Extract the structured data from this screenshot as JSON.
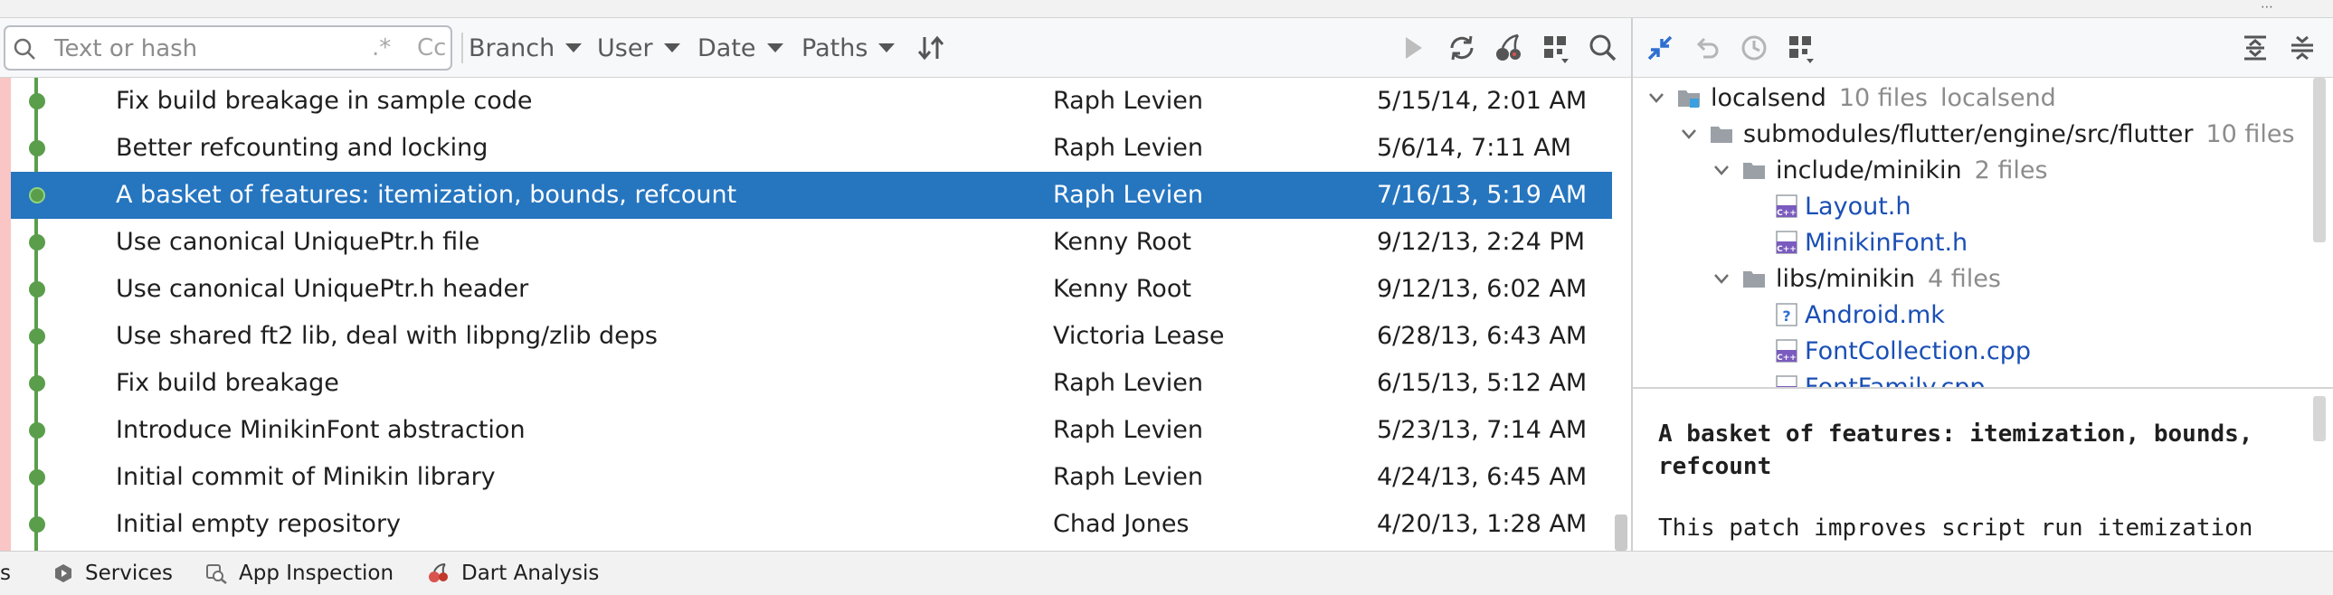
{
  "top_strip": {
    "corner_glyph": "⋯"
  },
  "search": {
    "placeholder": "Text or hash",
    "value": "",
    "regex_label": ".*",
    "case_label": "Cc"
  },
  "filters": [
    {
      "label": "Branch"
    },
    {
      "label": "User"
    },
    {
      "label": "Date"
    },
    {
      "label": "Paths"
    }
  ],
  "toolbar_icons": [
    "sort-icon",
    "play-icon",
    "refresh-icon",
    "cherry-pick-icon",
    "layout-grid-icon",
    "search-icon"
  ],
  "commits": [
    {
      "subject": "Fix build breakage in sample code",
      "author": "Raph Levien",
      "date": "5/15/14, 2:01 AM"
    },
    {
      "subject": "Better refcounting and locking",
      "author": "Raph Levien",
      "date": "5/6/14, 7:11 AM"
    },
    {
      "subject": "A basket of features: itemization, bounds, refcount",
      "author": "Raph Levien",
      "date": "7/16/13, 5:19 AM",
      "selected": true
    },
    {
      "subject": "Use canonical UniquePtr.h file",
      "author": "Kenny Root",
      "date": "9/12/13, 2:24 PM"
    },
    {
      "subject": "Use canonical UniquePtr.h header",
      "author": "Kenny Root",
      "date": "9/12/13, 6:02 AM"
    },
    {
      "subject": "Use shared ft2 lib, deal with libpng/zlib deps",
      "author": "Victoria Lease",
      "date": "6/28/13, 6:43 AM"
    },
    {
      "subject": "Fix build breakage",
      "author": "Raph Levien",
      "date": "6/15/13, 5:12 AM"
    },
    {
      "subject": "Introduce MinikinFont abstraction",
      "author": "Raph Levien",
      "date": "5/23/13, 7:14 AM"
    },
    {
      "subject": "Initial commit of Minikin library",
      "author": "Raph Levien",
      "date": "4/24/13, 6:45 AM"
    },
    {
      "subject": "Initial empty repository",
      "author": "Chad Jones",
      "date": "4/20/13, 1:28 AM"
    }
  ],
  "tree": {
    "root": {
      "name": "localsend",
      "count": "10 files",
      "extra": "localsend"
    },
    "sub": {
      "name": "submodules/flutter/engine/src/flutter",
      "count": "10 files"
    },
    "dir1": {
      "name": "include/minikin",
      "count": "2 files"
    },
    "file1": {
      "name": "Layout.h"
    },
    "file2": {
      "name": "MinikinFont.h"
    },
    "dir2": {
      "name": "libs/minikin",
      "count": "4 files"
    },
    "file3": {
      "name": "Android.mk"
    },
    "file4": {
      "name": "FontCollection.cpp"
    },
    "file5": {
      "name": "FontFamily.cpp"
    }
  },
  "details": {
    "title_line1": "A basket of features: itemization, bounds,",
    "title_line2": "refcount",
    "body_line1": "This patch improves script run itemization"
  },
  "bottom_tabs": [
    {
      "label": "s"
    },
    {
      "label": "Services"
    },
    {
      "label": "App Inspection"
    },
    {
      "label": "Dart Analysis"
    }
  ],
  "colors": {
    "selection": "#2675bf",
    "graph": "#5a9e4b",
    "file_link": "#1a4fb5",
    "gutter": "#f9c5c5"
  }
}
